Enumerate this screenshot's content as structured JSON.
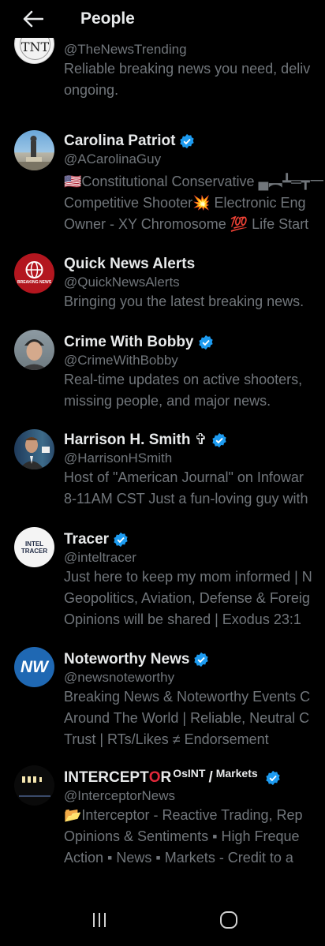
{
  "header": {
    "title": "People"
  },
  "users": [
    {
      "name": "",
      "handle": "@TheNewsTrending",
      "bio": [
        "Reliable breaking news you need, deliv",
        "ongoing."
      ]
    },
    {
      "name": "Carolina Patriot",
      "handle": "@ACarolinaGuy",
      "verified": true,
      "bio": [
        "🇺🇸Constitutional Conservative ▄︻┻═┳一",
        "Competitive Shooter💥 Electronic Eng",
        "Owner - XY Chromosome 💯 Life Start"
      ]
    },
    {
      "name": "Quick News Alerts",
      "handle": "@QuickNewsAlerts",
      "verified": false,
      "avatar_text": "BREAKING NEWS",
      "bio": [
        "Bringing you the latest breaking news."
      ]
    },
    {
      "name": "Crime With Bobby",
      "handle": "@CrimeWithBobby",
      "verified": true,
      "bio": [
        "Real-time updates on active shooters,",
        "missing people, and major news."
      ]
    },
    {
      "name": "Harrison H. Smith ✞",
      "handle": "@HarrisonHSmith",
      "verified": true,
      "bio": [
        "Host of \"American Journal\" on Infowar",
        "8-11AM CST  Just a fun-loving guy with"
      ]
    },
    {
      "name": "Tracer",
      "handle": "@inteltracer",
      "verified": true,
      "avatar_text": "INTEL TRACER",
      "bio": [
        "Just here to keep my mom informed | N",
        "Geopolitics, Aviation, Defense & Foreig",
        "Opinions will be shared | Exodus 23:1"
      ]
    },
    {
      "name": "Noteworthy News",
      "handle": "@newsnoteworthy",
      "verified": true,
      "avatar_text": "NW",
      "bio": [
        "Breaking News & Noteworthy Events C",
        "Around The World | Reliable, Neutral C",
        "Trust | RTs/Likes ≠ Endorsement"
      ]
    },
    {
      "name_main": "INTERCEPT",
      "name_o": "O",
      "name_tail": "R",
      "name_sup1": "OsINT",
      "name_slash": "/",
      "name_sup2": "Markets",
      "handle": "@InterceptorNews",
      "verified": true,
      "bio": [
        "📂Interceptor -  Reactive Trading, Rep",
        "Opinions & Sentiments ▪ High Freque",
        "Action  ▪ News  ▪ Markets - Credit to a"
      ]
    }
  ],
  "colors": {
    "accent": "#1d9bf0",
    "secondary": "#71767b",
    "primary": "#e7e9ea"
  },
  "icons": {
    "back": "arrow-left-icon",
    "verified": "verified-badge-icon",
    "recents": "recent-apps-icon",
    "home": "home-button-icon"
  }
}
